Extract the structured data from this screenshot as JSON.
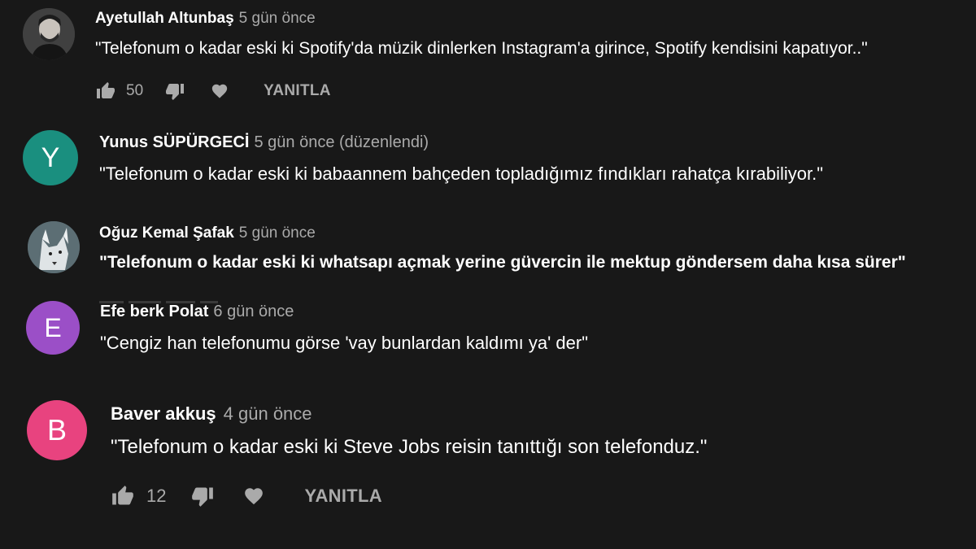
{
  "colors": {
    "background": "#181818",
    "author": "#ffffff",
    "meta": "#aaaaaa",
    "avatar_y": "#1a8f7f",
    "avatar_e": "#9b4fc7",
    "avatar_b": "#e8437f"
  },
  "comments": [
    {
      "author": "Ayetullah Altunbaş",
      "time": "5 gün önce",
      "text": "\"Telefonum o kadar eski ki Spotify'da müzik dinlerken Instagram'a girince, Spotify kendisini kapatıyor..\"",
      "avatar": "photo-person",
      "likes": "50",
      "reply": "YANITLA"
    },
    {
      "author": "Yunus SÜPÜRGECİ",
      "time": "5 gün önce (düzenlendi)",
      "text": "\"Telefonum o kadar eski ki babaannem bahçeden topladığımız fındıkları rahatça kırabiliyor.\"",
      "avatar_letter": "Y"
    },
    {
      "author": "Oğuz Kemal Şafak",
      "time": "5 gün önce",
      "text": "\"Telefonum o kadar eski ki whatsapı açmak yerine güvercin ile mektup göndersem daha kısa sürer\"",
      "avatar": "photo-wolf"
    },
    {
      "author": "Efe berk Polat",
      "time": "6 gün önce",
      "text": "\"Cengiz han telefonumu görse 'vay bunlardan kaldımı ya' der\"",
      "avatar_letter": "E"
    },
    {
      "author": "Baver akkuş",
      "time": "4 gün önce",
      "text": "\"Telefonum o kadar eski ki Steve Jobs reisin tanıttığı son telefonduz.\"",
      "avatar_letter": "B",
      "likes": "12",
      "reply": "YANITLA"
    }
  ],
  "icons": {
    "like": "thumbs-up-icon",
    "dislike": "thumbs-down-icon",
    "heart": "heart-icon"
  }
}
